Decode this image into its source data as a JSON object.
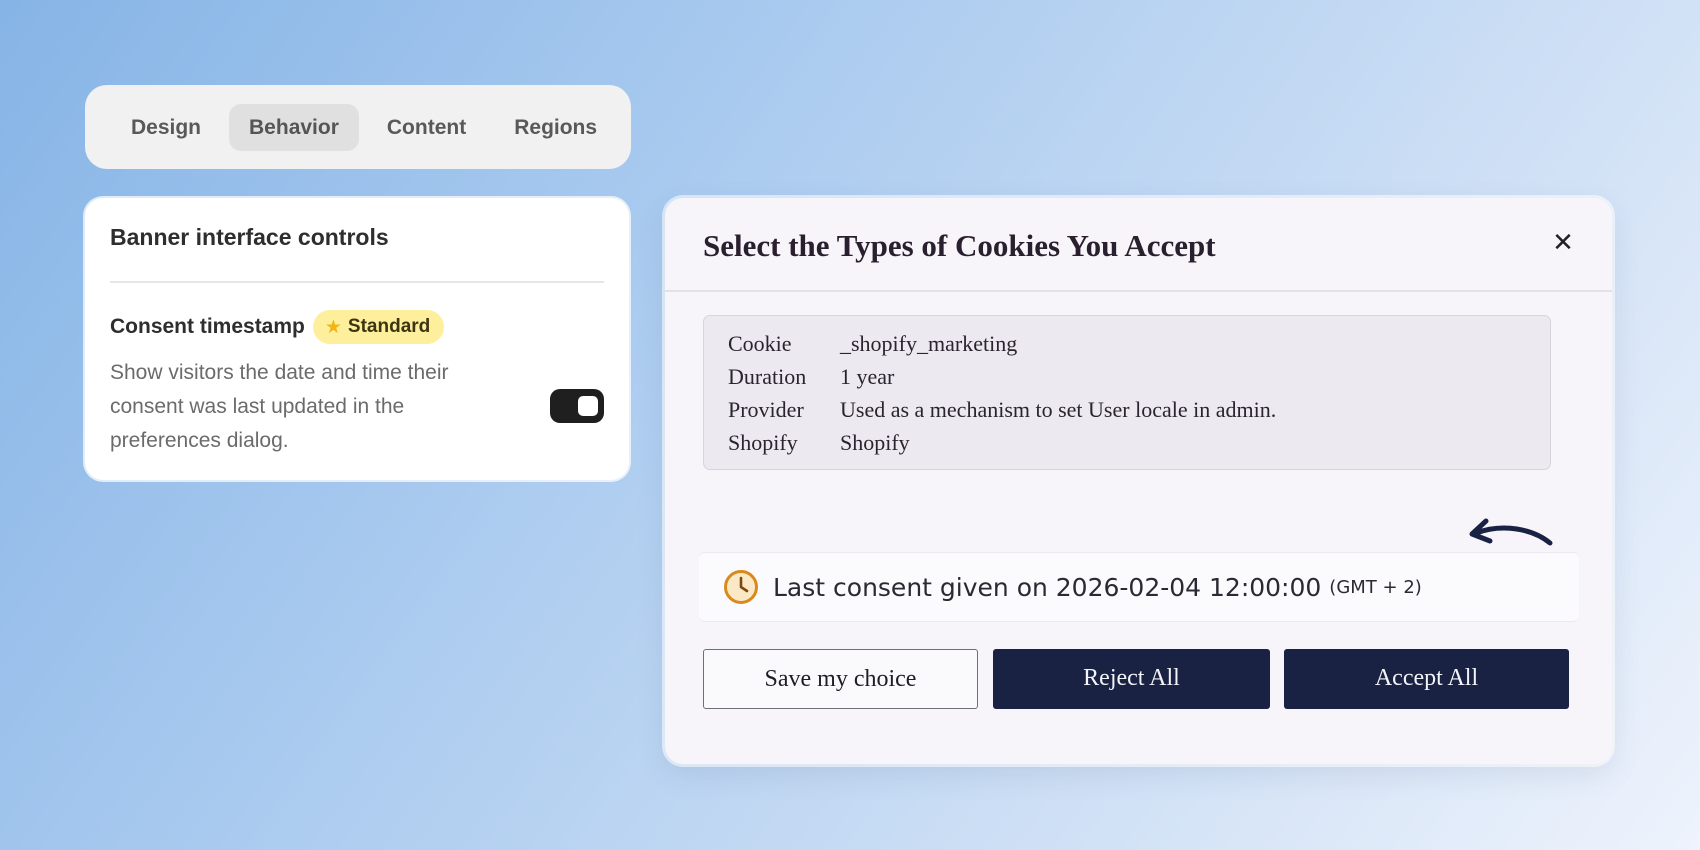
{
  "tabs": [
    {
      "label": "Design",
      "active": false
    },
    {
      "label": "Behavior",
      "active": true
    },
    {
      "label": "Content",
      "active": false
    },
    {
      "label": "Regions",
      "active": false
    }
  ],
  "settings": {
    "title": "Banner interface controls",
    "row": {
      "title": "Consent timestamp",
      "badge": "Standard",
      "badge_icon": "star-icon",
      "description": "Show visitors the date and time their consent was last updated in the preferences dialog.",
      "toggle_on": true
    }
  },
  "dialog": {
    "title": "Select the Types of Cookies You Accept",
    "close_icon": "close-icon",
    "info": [
      {
        "label": "Cookie",
        "value": "_shopify_marketing"
      },
      {
        "label": "Duration",
        "value": "1 year"
      },
      {
        "label": "Provider",
        "value": "Used as a mechanism to set User locale in admin."
      },
      {
        "label": "Shopify",
        "value": "Shopify"
      }
    ],
    "consent": {
      "icon": "clock-icon",
      "text": "Last consent given on 2026-02-04 12:00:00",
      "timezone": "(GMT + 2)"
    },
    "buttons": {
      "save": "Save my choice",
      "reject": "Reject All",
      "accept": "Accept All"
    }
  },
  "colors": {
    "dark_navy": "#1a2244",
    "badge_yellow": "#fdef9c",
    "clock_orange": "#d98a1e"
  }
}
